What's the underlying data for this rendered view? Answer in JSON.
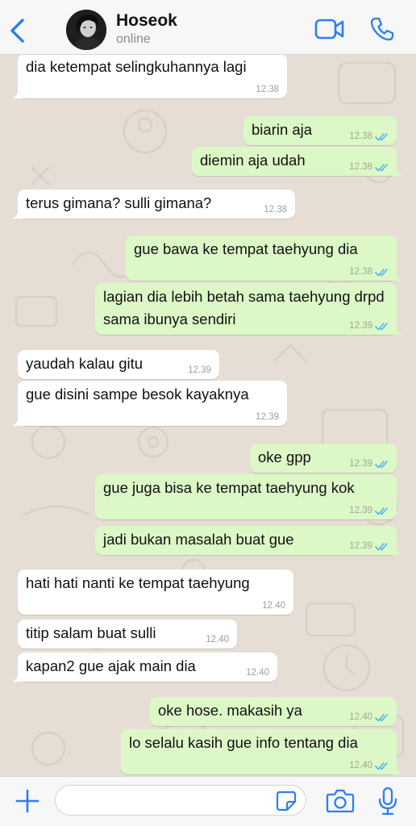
{
  "header": {
    "contact_name": "Hoseok",
    "contact_status": "online"
  },
  "colors": {
    "accent": "#2b7ff5",
    "incoming_bubble": "#ffffff",
    "outgoing_bubble": "#dcf8c6",
    "wallpaper": "#e6ded5",
    "read_ticks": "#4fb3f6"
  },
  "icons": {
    "back": "chevron-left-icon",
    "video": "video-camera-icon",
    "phone": "phone-icon",
    "attach": "plus-icon",
    "sticker": "sticker-icon",
    "camera": "camera-icon",
    "mic": "microphone-icon"
  },
  "messages": [
    {
      "dir": "in",
      "text": "dia ketempat selingkuhannya lagi",
      "time": "12.38"
    },
    {
      "dir": "out",
      "text": "biarin aja",
      "time": "12.38",
      "status": "read"
    },
    {
      "dir": "out",
      "text": "diemin aja udah",
      "time": "12.38",
      "status": "read"
    },
    {
      "dir": "in",
      "text": "terus gimana? sulli gimana?",
      "time": "12.38"
    },
    {
      "dir": "out",
      "text": "gue bawa ke tempat taehyung dia",
      "time": "12.38",
      "status": "read"
    },
    {
      "dir": "out",
      "text": "lagian dia lebih betah sama taehyung drpd sama ibunya sendiri",
      "time": "12.39",
      "status": "read"
    },
    {
      "dir": "in",
      "text": "yaudah kalau gitu",
      "time": "12.39"
    },
    {
      "dir": "in",
      "text": "gue disini sampe besok kayaknya",
      "time": "12.39"
    },
    {
      "dir": "out",
      "text": "oke gpp",
      "time": "12.39",
      "status": "read"
    },
    {
      "dir": "out",
      "text": "gue juga bisa ke tempat taehyung kok",
      "time": "12.39",
      "status": "read"
    },
    {
      "dir": "out",
      "text": "jadi bukan masalah buat gue",
      "time": "12.39",
      "status": "read"
    },
    {
      "dir": "in",
      "text": "hati hati nanti ke tempat taehyung",
      "time": "12.40"
    },
    {
      "dir": "in",
      "text": "titip salam buat sulli",
      "time": "12.40"
    },
    {
      "dir": "in",
      "text": "kapan2 gue ajak main dia",
      "time": "12.40"
    },
    {
      "dir": "out",
      "text": "oke hose. makasih ya",
      "time": "12.40",
      "status": "read"
    },
    {
      "dir": "out",
      "text": "lo selalu kasih gue info tentang dia",
      "time": "12.40",
      "status": "read"
    }
  ],
  "input": {
    "placeholder": "",
    "value": ""
  }
}
